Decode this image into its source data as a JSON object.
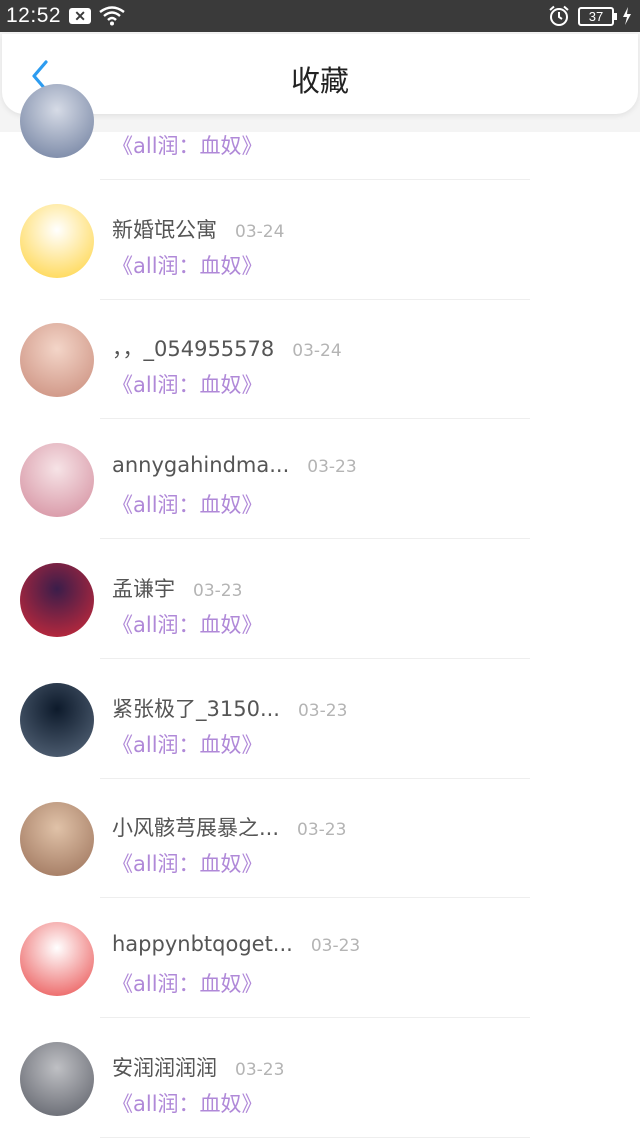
{
  "status_bar": {
    "time": "12:52",
    "notification_icon": "notification-x-icon",
    "wifi_icon": "wifi-icon",
    "alarm_icon": "alarm-icon",
    "battery_level": "37",
    "charging_icon": "charging-icon"
  },
  "header": {
    "title": "收藏",
    "back_icon": "chevron-left-icon",
    "accent_color": "#2d9cf0"
  },
  "favorites": [
    {
      "name": "",
      "date": "",
      "title": "《all润：血奴》",
      "avatar_colors": [
        "#d6dbe6",
        "#6b7b9c"
      ]
    },
    {
      "name": "新婚氓公寓",
      "date": "03-24",
      "title": "《all润：血奴》",
      "avatar_colors": [
        "#ffffff",
        "#ffd23a"
      ]
    },
    {
      "name": "，，_054955578",
      "date": "03-24",
      "title": "《all润：血奴》",
      "avatar_colors": [
        "#f3d5c8",
        "#c98b7a"
      ]
    },
    {
      "name": "annygahindma...",
      "date": "03-23",
      "title": "《all润：血奴》",
      "avatar_colors": [
        "#f6e3e6",
        "#d38b9c"
      ]
    },
    {
      "name": "孟谦宇",
      "date": "03-23",
      "title": "《all润：血奴》",
      "avatar_colors": [
        "#3a1d4a",
        "#d22a3a"
      ]
    },
    {
      "name": "紧张极了_3150...",
      "date": "03-23",
      "title": "《all润：血奴》",
      "avatar_colors": [
        "#0d1a2b",
        "#5a6a7e"
      ]
    },
    {
      "name": "小风骸芎展暴之...",
      "date": "03-23",
      "title": "《all润：血奴》",
      "avatar_colors": [
        "#e0c2a8",
        "#9a7058"
      ]
    },
    {
      "name": "happynbtqoget...",
      "date": "03-23",
      "title": "《all润：血奴》",
      "avatar_colors": [
        "#ffffff",
        "#e94a4a"
      ]
    },
    {
      "name": "安润润润润",
      "date": "03-23",
      "title": "《all润：血奴》",
      "avatar_colors": [
        "#bfc0c4",
        "#5a5d66"
      ]
    }
  ]
}
